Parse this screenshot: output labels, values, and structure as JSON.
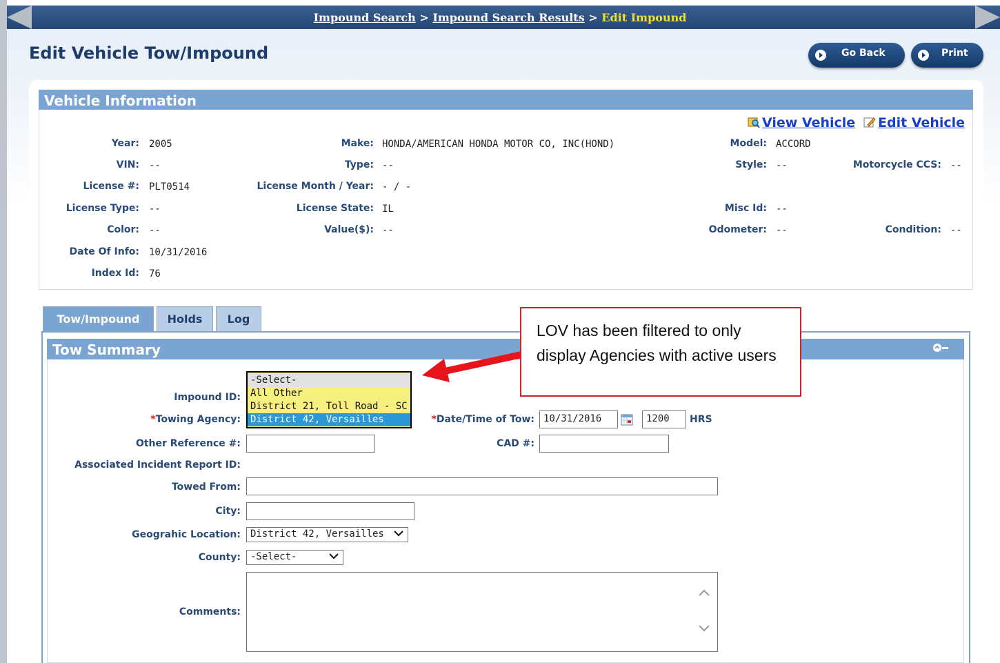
{
  "nav": {
    "crumb1": "Impound Search",
    "crumb2": "Impound Search Results",
    "current": "Edit Impound",
    "sep": ">"
  },
  "page": {
    "title": "Edit Vehicle Tow/Impound"
  },
  "buttons": {
    "go_back": "Go Back",
    "print": "Print"
  },
  "vehicle": {
    "header": "Vehicle Information",
    "view_link": "View Vehicle",
    "edit_link": "Edit Vehicle",
    "fields": {
      "year": {
        "label": "Year:",
        "value": "2005"
      },
      "make": {
        "label": "Make:",
        "value": "HONDA/AMERICAN HONDA MOTOR CO, INC(HOND)"
      },
      "model": {
        "label": "Model:",
        "value": "ACCORD"
      },
      "vin": {
        "label": "VIN:",
        "value": "--"
      },
      "type": {
        "label": "Type:",
        "value": "--"
      },
      "style": {
        "label": "Style:",
        "value": "--"
      },
      "motorcycle_ccs": {
        "label": "Motorcycle CCS:",
        "value": "--"
      },
      "license": {
        "label": "License #:",
        "value": "PLT0514"
      },
      "license_month_year": {
        "label": "License Month / Year:",
        "value": "- / -"
      },
      "license_type": {
        "label": "License Type:",
        "value": "--"
      },
      "license_state": {
        "label": "License State:",
        "value": "IL"
      },
      "misc_id": {
        "label": "Misc Id:",
        "value": "--"
      },
      "color": {
        "label": "Color:",
        "value": "--"
      },
      "value": {
        "label": "Value($):",
        "value": "--"
      },
      "odometer": {
        "label": "Odometer:",
        "value": "--"
      },
      "condition": {
        "label": "Condition:",
        "value": "--"
      },
      "date_of_info": {
        "label": "Date Of Info:",
        "value": "10/31/2016"
      },
      "index_id": {
        "label": "Index Id:",
        "value": "76"
      }
    }
  },
  "tabs": [
    "Tow/Impound",
    "Holds",
    "Log"
  ],
  "tow_summary": {
    "header": "Tow Summary",
    "impound_id_label": "Impound ID:",
    "towing_agency_label": "Towing Agency:",
    "towing_agency_options": [
      "-Select-",
      "All Other",
      "District 21, Toll Road - SC",
      "District 42, Versailles"
    ],
    "towing_agency_selected": "District 42, Versailles",
    "date_time_label": "Date/Time of Tow:",
    "date_value": "10/31/2016",
    "time_value": "1200",
    "hrs_label": "HRS",
    "other_ref_label": "Other Reference #:",
    "cad_label": "CAD #:",
    "assoc_incident_label": "Associated Incident Report ID:",
    "towed_from_label": "Towed From:",
    "city_label": "City:",
    "geo_label": "Geograhic Location:",
    "geo_value": "District 42, Versailles",
    "county_label": "County:",
    "county_value": "-Select-",
    "comments_label": "Comments:",
    "required_mark": "*"
  },
  "callout": {
    "text": "LOV has been filtered to only display Agencies with active users"
  },
  "colors": {
    "header_blue": "#7aa4d1",
    "nav_dark": "#234674",
    "breadcrumb_current": "#f2e12e",
    "listbox_yellow": "#f6f07e",
    "selected_blue": "#2b98d8",
    "callout_border": "#c0282b"
  }
}
